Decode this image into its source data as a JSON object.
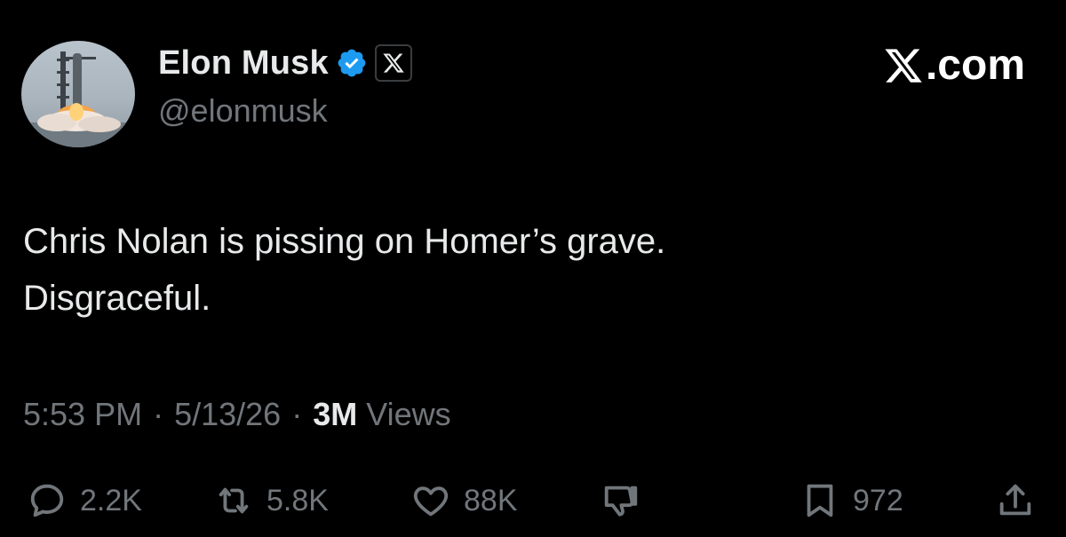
{
  "author": {
    "display_name": "Elon Musk",
    "handle": "@elonmusk",
    "verified_icon": "verified-badge-icon",
    "affiliate_icon": "x-logo-icon",
    "avatar_icon": "rocket-launch-avatar"
  },
  "brand": {
    "watermark": ".com",
    "logo_icon": "x-logo-icon"
  },
  "tweet": {
    "lines": [
      "Chris Nolan is pissing on Homer’s grave.",
      "Disgraceful."
    ]
  },
  "meta": {
    "time": "5:53 PM",
    "separator": "·",
    "date": "5/13/26",
    "views_count": "3M",
    "views_label": "Views"
  },
  "actions": {
    "reply": {
      "icon": "reply-icon",
      "count": "2.2K"
    },
    "repost": {
      "icon": "repost-icon",
      "count": "5.8K"
    },
    "like": {
      "icon": "heart-icon",
      "count": "88K"
    },
    "dislike": {
      "icon": "thumbs-down-icon"
    },
    "bookmark": {
      "icon": "bookmark-icon",
      "count": "972"
    },
    "share": {
      "icon": "share-icon"
    }
  },
  "colors": {
    "background": "#000000",
    "primary_text": "#e7e9ea",
    "secondary_text": "#71767b",
    "verified_blue": "#1d9bf0"
  }
}
